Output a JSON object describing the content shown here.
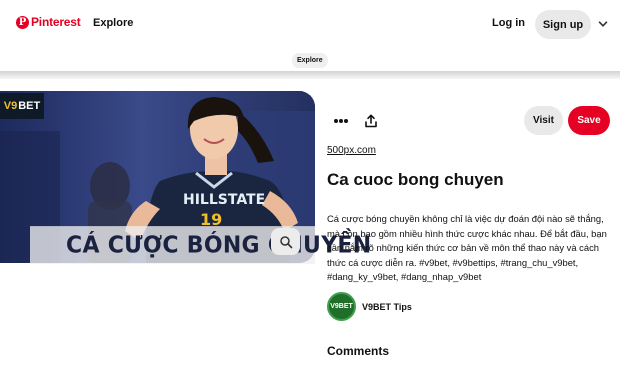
{
  "header": {
    "brand": "Pinterest",
    "brand_mark": "P",
    "nav_explore": "Explore",
    "login_label": "Log in",
    "signup_label": "Sign up",
    "menu_icon": "chevron-down-icon"
  },
  "breadcrumb": {
    "label": "Explore"
  },
  "pin": {
    "badge_prefix": "V9",
    "badge_suffix": "BET",
    "caption": "CÁ CƯỢC BÓNG CHUYỀN",
    "jersey_text": "HILLSTATE",
    "jersey_number": "19",
    "lens_icon": "visual-search-icon"
  },
  "actions": {
    "more_icon": "more-icon",
    "share_icon": "share-icon",
    "visit_label": "Visit",
    "save_label": "Save"
  },
  "details": {
    "source": "500px.com",
    "title": "Ca cuoc bong chuyen",
    "description": "Cá cược bóng chuyền không chỉ là việc dự đoán đội nào sẽ thắng, mà còn bao gồm nhiều hình thức cược khác nhau. Để bắt đầu, bạn cần nắm rõ những kiến thức cơ bản về môn thể thao này và cách thức cá cược diễn ra. #v9bet, #v9bettips, #trang_chu_v9bet, #dang_ky_v9bet, #dang_nhap_v9bet"
  },
  "creator": {
    "avatar_text": "V9BET",
    "name": "V9BET Tips"
  },
  "comments": {
    "heading": "Comments"
  },
  "colors": {
    "brand_red": "#e60023",
    "button_gray": "#e9e9e9"
  }
}
